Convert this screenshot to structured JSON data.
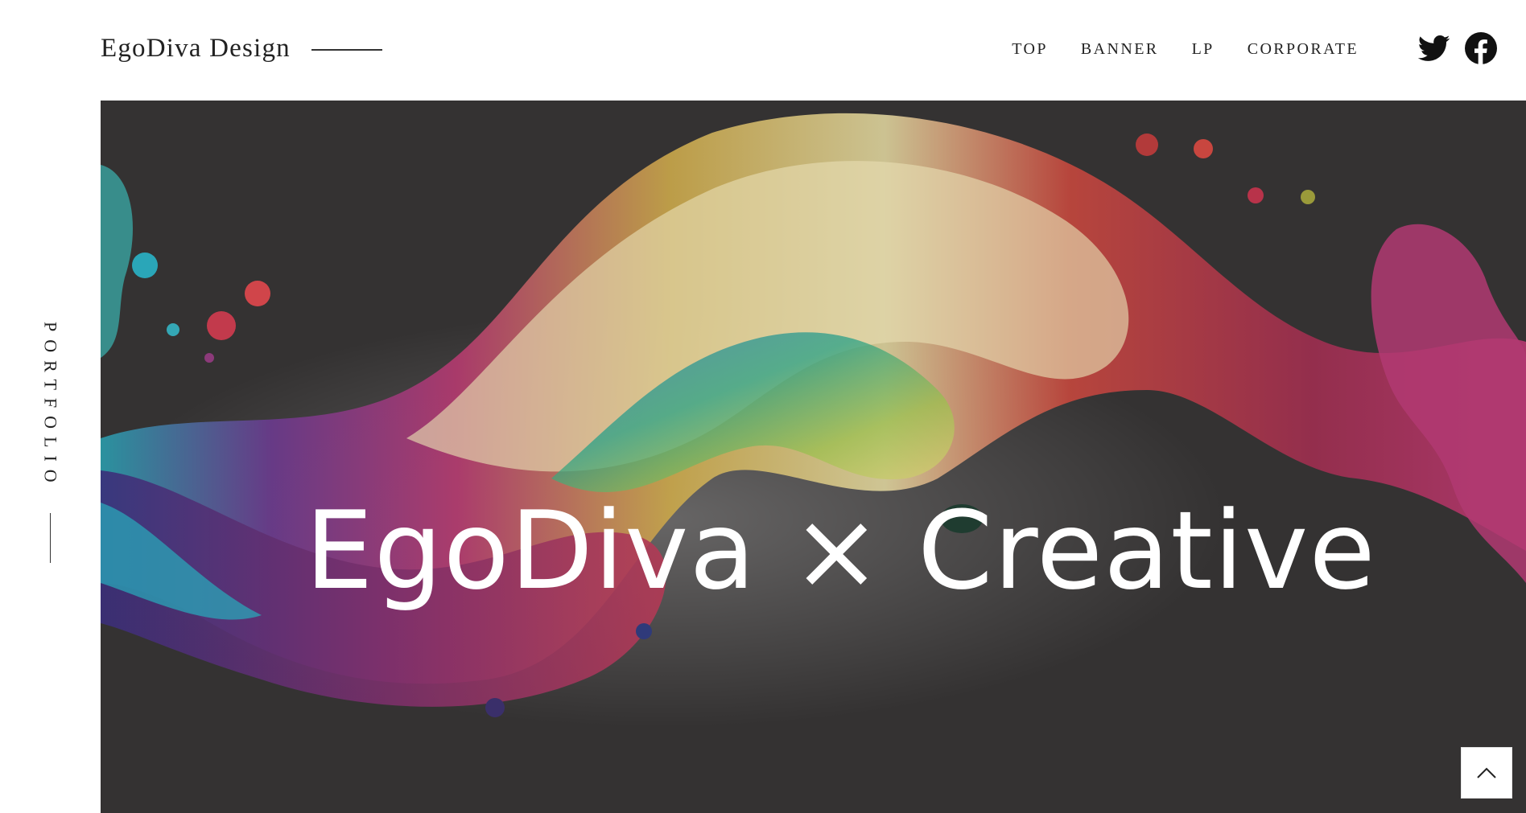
{
  "header": {
    "brand": "EgoDiva Design",
    "nav": [
      {
        "label": "TOP"
      },
      {
        "label": "BANNER"
      },
      {
        "label": "LP"
      },
      {
        "label": "CORPORATE"
      }
    ],
    "social": [
      {
        "icon": "twitter-icon"
      },
      {
        "icon": "facebook-icon"
      }
    ]
  },
  "side_label": "PORTFOLIO",
  "hero": {
    "title": "EgoDiva × Creative",
    "background_color": "#343232"
  },
  "back_to_top": {
    "icon": "chevron-up-icon"
  }
}
